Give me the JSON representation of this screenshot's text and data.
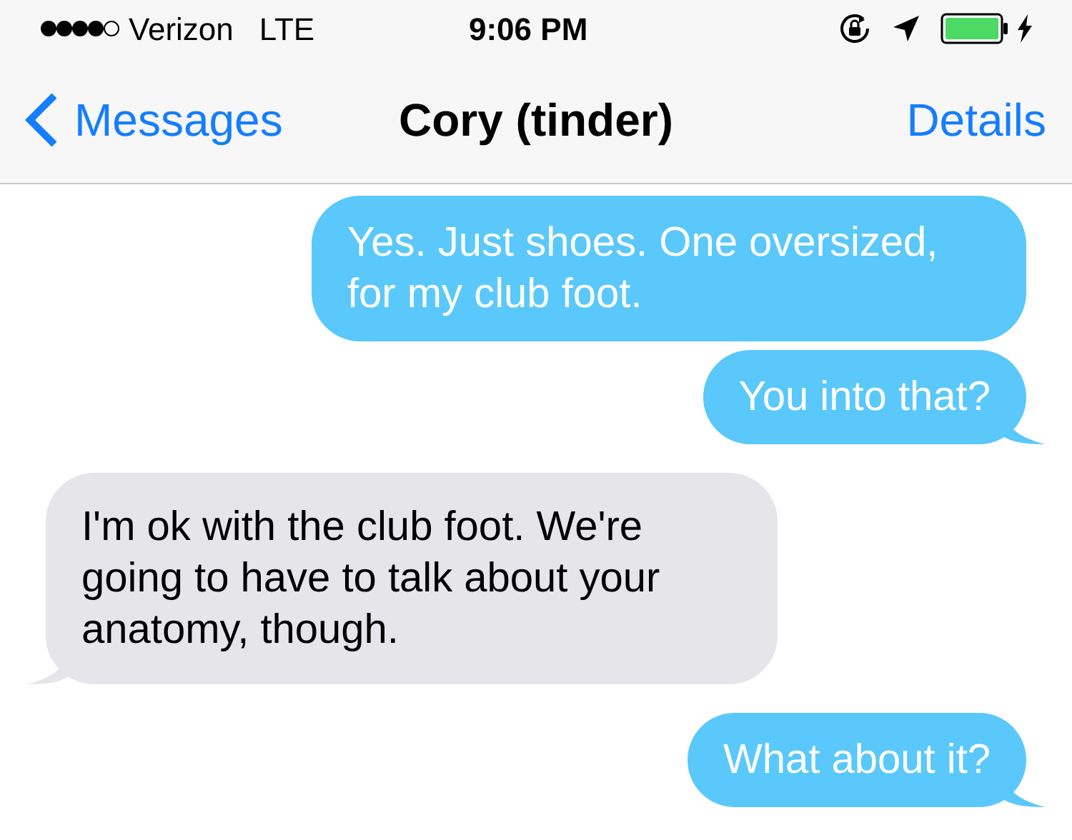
{
  "status_bar": {
    "carrier": "Verizon",
    "network": "LTE",
    "time": "9:06 PM"
  },
  "nav": {
    "back": "Messages",
    "title": "Cory (tinder)",
    "action": "Details"
  },
  "messages": [
    {
      "kind": "sent",
      "text": "Yes. Just shoes. One oversized, for my club foot.",
      "tail": false
    },
    {
      "kind": "sent",
      "text": "You into that?",
      "tail": true
    },
    {
      "kind": "received",
      "text": "I'm ok with the club foot. We're going to have to talk about your anatomy, though.",
      "tail": true
    },
    {
      "kind": "sent",
      "text": "What about it?",
      "tail": true
    }
  ]
}
